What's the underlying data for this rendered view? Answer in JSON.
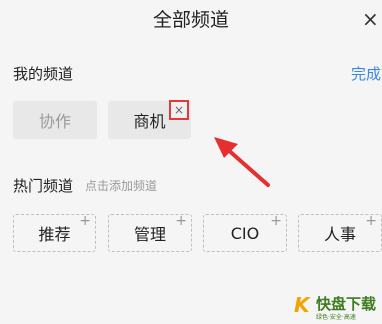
{
  "header": {
    "title": "全部频道",
    "close_glyph": "×"
  },
  "my_channels": {
    "label": "我的频道",
    "done_label": "完成",
    "items": [
      {
        "label": "协作",
        "fixed": true
      },
      {
        "label": "商机",
        "fixed": false
      }
    ],
    "remove_glyph": "×"
  },
  "hot_channels": {
    "label": "热门频道",
    "hint": "点击添加频道",
    "add_glyph": "+",
    "items": [
      {
        "label": "推荐"
      },
      {
        "label": "管理"
      },
      {
        "label": "CIO"
      },
      {
        "label": "人事"
      }
    ]
  },
  "watermark": {
    "logo_glyph": "K",
    "name": "快盘下载",
    "tagline": "绿色·安全·高速"
  },
  "colors": {
    "accent": "#3a86e8",
    "highlight": "#e03a3a",
    "background": "#f5f5f5",
    "chip_bg": "#e8e8e8"
  }
}
